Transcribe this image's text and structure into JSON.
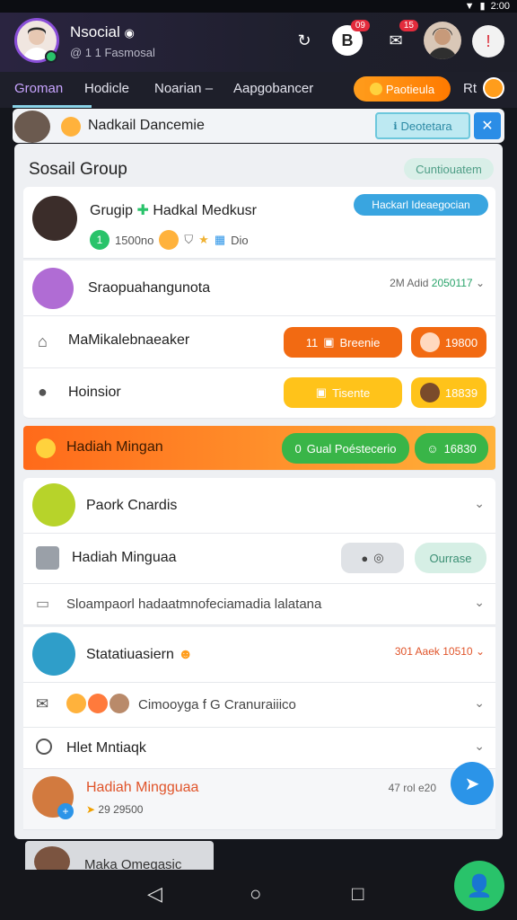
{
  "status": {
    "time": "2:00"
  },
  "header": {
    "title": "Nsocial",
    "subtitle": "@ 1 1 Fasmosal",
    "badges": {
      "bell": "09",
      "chat": "15"
    }
  },
  "tabs": [
    "Groman",
    "Hodicle",
    "Noarian",
    "Aapgobancer"
  ],
  "tab_separator": "–",
  "promo_pill": "Paotieula",
  "promo_extra": "Rt",
  "notification": {
    "text": "Nadkail Dancemie",
    "action": "Deotetara"
  },
  "card": {
    "title": "Sosail Group",
    "tag": "Cuntiouatem",
    "group": {
      "name": "Grugip",
      "name2": "Hadkal Medkusr",
      "button": "Hackarl Ideaegocian",
      "stat": "1500no",
      "extra": "Dio"
    },
    "item1": {
      "label": "Sraopuahangunota",
      "meta": "2M Adid",
      "meta2": "2050117"
    },
    "item2": {
      "label": "MaMikalebnaeaker",
      "btn1_num": "11",
      "btn1_label": "Breenie",
      "btn2_label": "19800"
    },
    "item3": {
      "label": "Hoinsior",
      "btn1_label": "Tisente",
      "btn2_label": "18839"
    },
    "highlight": {
      "label": "Hadiah Mingan",
      "btn1_num": "0",
      "btn1_label": "Gual Poéstecerio",
      "btn2_label": "16830"
    },
    "item4": {
      "label": "Paork Cnardis"
    },
    "item5": {
      "label": "Hadiah Minguaa",
      "btn_label": "Ourrase"
    },
    "item6": {
      "label": "Sloampaorl hadaatmnofeciamadia lalatana"
    },
    "item7": {
      "label": "Statatiuasiern",
      "meta": "301 Aaek",
      "meta2": "10510"
    },
    "item8": {
      "label": "Cimooyga f G Cranuraiiico"
    },
    "item9": {
      "label": "Hlet Mntiaqk"
    },
    "item10": {
      "label": "Hadiah Mingguaa",
      "meta": "47 rol",
      "meta2": "e20",
      "sub": "29 29500"
    }
  },
  "bottom_tab": "Maka Omegasic",
  "colors": {
    "accent_purple": "#8a4fd8",
    "orange": "#ff7a00",
    "yellow": "#ffc31a",
    "green": "#29c36a",
    "blue": "#2b94e8"
  }
}
